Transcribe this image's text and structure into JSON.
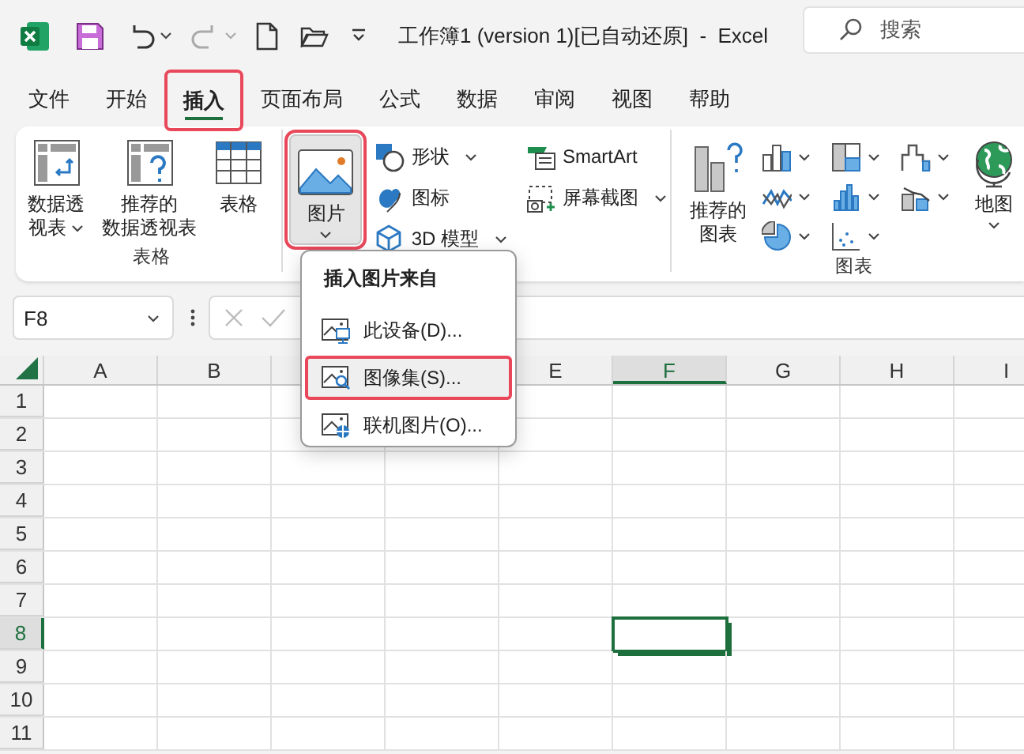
{
  "title_bar": {
    "title": "工作簿1 (version 1)[已自动还原]  -  Excel",
    "search": {
      "placeholder": "搜索"
    }
  },
  "tabs": [
    {
      "label": "文件",
      "selected": false,
      "highlighted": false
    },
    {
      "label": "开始",
      "selected": false,
      "highlighted": false
    },
    {
      "label": "插入",
      "selected": true,
      "highlighted": true
    },
    {
      "label": "页面布局",
      "selected": false,
      "highlighted": false
    },
    {
      "label": "公式",
      "selected": false,
      "highlighted": false
    },
    {
      "label": "数据",
      "selected": false,
      "highlighted": false
    },
    {
      "label": "审阅",
      "selected": false,
      "highlighted": false
    },
    {
      "label": "视图",
      "selected": false,
      "highlighted": false
    },
    {
      "label": "帮助",
      "selected": false,
      "highlighted": false
    }
  ],
  "ribbon": {
    "tables_group": {
      "label": "表格",
      "buttons": [
        {
          "label": "数据透视表",
          "dropdown": true
        },
        {
          "label": "推荐的数据透视表",
          "dropdown": false
        },
        {
          "label": "表格",
          "dropdown": false
        }
      ]
    },
    "illustrations_group": {
      "picture_button": {
        "label": "图片",
        "dropdown": true,
        "selected": true,
        "highlighted": true
      },
      "small_buttons": [
        {
          "label": "形状",
          "dropdown": true
        },
        {
          "label": "图标",
          "dropdown": false
        },
        {
          "label": "3D 模型",
          "dropdown": true
        },
        {
          "label": "SmartArt",
          "dropdown": false
        },
        {
          "label": "屏幕截图",
          "dropdown": true
        }
      ]
    },
    "charts_group": {
      "label": "图表",
      "recommended": {
        "label": "推荐的图表"
      },
      "map": {
        "label": "地图",
        "dropdown": true
      }
    }
  },
  "formula_bar": {
    "name_box": "F8"
  },
  "insert_picture_menu": {
    "title": "插入图片来自",
    "items": [
      {
        "label": "此设备(D)...",
        "selected": false,
        "highlighted": false
      },
      {
        "label": "图像集(S)...",
        "selected": true,
        "highlighted": true
      },
      {
        "label": "联机图片(O)...",
        "selected": false,
        "highlighted": false
      }
    ]
  },
  "sheet": {
    "columns": [
      {
        "label": "A",
        "selected": false
      },
      {
        "label": "B",
        "selected": false
      },
      {},
      {},
      {
        "label": "E",
        "selected": false
      },
      {
        "label": "F",
        "selected": true
      },
      {
        "label": "G",
        "selected": false
      },
      {
        "label": "H",
        "selected": false
      },
      {
        "label": "I",
        "selected": false
      }
    ],
    "rows": [
      {
        "label": "1",
        "selected": false
      },
      {
        "label": "2",
        "selected": false
      },
      {
        "label": "3",
        "selected": false
      },
      {
        "label": "4",
        "selected": false
      },
      {
        "label": "5",
        "selected": false
      },
      {
        "label": "6",
        "selected": false
      },
      {
        "label": "7",
        "selected": false
      },
      {
        "label": "8",
        "selected": true
      },
      {
        "label": "9",
        "selected": false
      },
      {
        "label": "10",
        "selected": false
      },
      {
        "label": "11",
        "selected": false
      }
    ]
  }
}
